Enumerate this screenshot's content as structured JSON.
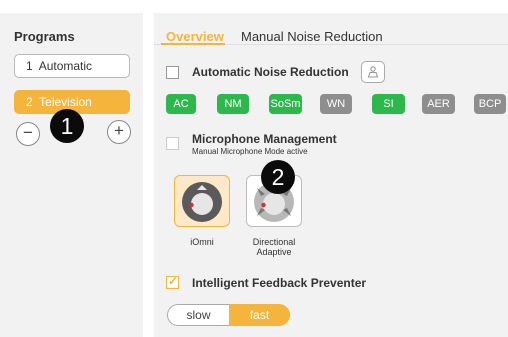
{
  "programs": {
    "title": "Programs",
    "items": [
      {
        "number": "1",
        "name": "Automatic"
      },
      {
        "number": "2",
        "name": "Television"
      }
    ],
    "remove_symbol": "−",
    "add_symbol": "+"
  },
  "callouts": {
    "one": "1",
    "two": "2"
  },
  "tabs": {
    "overview": "Overview",
    "mnr": "Manual Noise Reduction"
  },
  "anr": {
    "label": "Automatic Noise Reduction",
    "checked": false,
    "chips": [
      {
        "label": "AC",
        "state": "on"
      },
      {
        "label": "NM",
        "state": "on"
      },
      {
        "label": "SoSm",
        "state": "on"
      },
      {
        "label": "WN",
        "state": "off"
      },
      {
        "label": "SI",
        "state": "on"
      },
      {
        "label": "AER",
        "state": "off"
      },
      {
        "label": "BCP",
        "state": "off"
      }
    ]
  },
  "microphone": {
    "label": "Microphone Management",
    "sublabel": "Manual Microphone Mode active",
    "modes": [
      {
        "label": "iOmni",
        "selected": true
      },
      {
        "label_line1": "Directional",
        "label_line2": "Adaptive",
        "selected": false
      }
    ]
  },
  "ifp": {
    "label": "Intelligent Feedback Preventer",
    "checked": true
  },
  "speed": {
    "slow": "slow",
    "fast": "fast",
    "selected": "fast"
  },
  "colors": {
    "accent": "#f5b43c",
    "chip_on": "#2db84c",
    "chip_off": "#8e8e8e"
  }
}
